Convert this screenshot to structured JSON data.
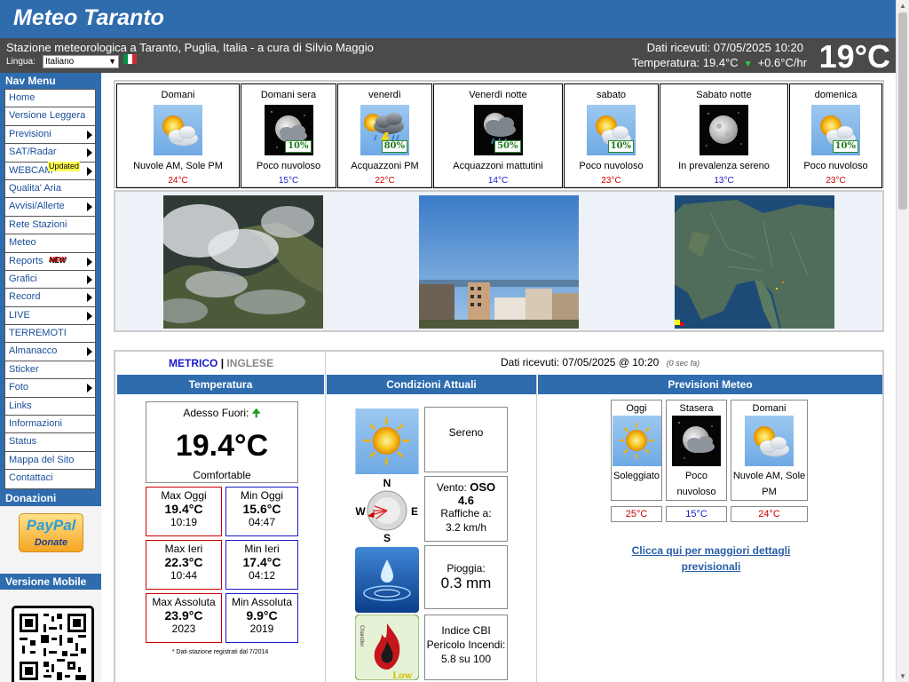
{
  "header": {
    "site_title": "Meteo Taranto",
    "station_line": "Stazione meteorologica a Taranto, Puglia, Italia - a cura di Silvio Maggio",
    "language_label": "Lingua:",
    "language_value": "Italiano",
    "data_received": "Dati ricevuti:  07/05/2025 10:20",
    "temperature_text": "Temperatura: 19.4°C",
    "temperature_trend": "+0.6°C/hr",
    "big_temp": "19°C"
  },
  "sidebar": {
    "nav_title": "Nav Menu",
    "items": [
      {
        "label": "Home",
        "arrow": false
      },
      {
        "label": "Versione Leggera",
        "arrow": false
      },
      {
        "label": "Previsioni",
        "arrow": true
      },
      {
        "label": "SAT/Radar",
        "arrow": true
      },
      {
        "label": "WEBCAM",
        "arrow": true,
        "badge": "Updated"
      },
      {
        "label": "Qualita' Aria",
        "arrow": false
      },
      {
        "label": "Avvisi/Allerte",
        "arrow": true
      },
      {
        "label": "Rete Stazioni",
        "arrow": false
      },
      {
        "label": "Meteo",
        "arrow": false
      },
      {
        "label": "Reports",
        "arrow": true,
        "badge": "NEW"
      },
      {
        "label": "Grafici",
        "arrow": true
      },
      {
        "label": "Record",
        "arrow": true
      },
      {
        "label": "LIVE",
        "arrow": true
      },
      {
        "label": "TERREMOTI",
        "arrow": false
      },
      {
        "label": "Almanacco",
        "arrow": true
      },
      {
        "label": "Sticker",
        "arrow": false
      },
      {
        "label": "Foto",
        "arrow": true
      },
      {
        "label": "Links",
        "arrow": false
      },
      {
        "label": "Informazioni",
        "arrow": false
      },
      {
        "label": "Status",
        "arrow": false
      },
      {
        "label": "Mappa del Sito",
        "arrow": false
      },
      {
        "label": "Contattaci",
        "arrow": false
      }
    ],
    "donations_title": "Donazioni",
    "paypal_label": "PayPal",
    "paypal_sub": "Donate",
    "mobile_title": "Versione Mobile"
  },
  "forecast": [
    {
      "title": "Domani",
      "icon": "partly-cloudy-sun-icon",
      "pop": "",
      "desc": "Nuvole AM, Sole PM",
      "temp": "24°C",
      "temp_color": "red"
    },
    {
      "title": "Domani sera",
      "icon": "cloudy-night-icon",
      "pop": "10%",
      "desc": "Poco nuvoloso",
      "temp": "15°C",
      "temp_color": "blue"
    },
    {
      "title": "venerdì",
      "icon": "thunderstorm-sun-icon",
      "pop": "80%",
      "desc": "Acquazzoni PM",
      "temp": "22°C",
      "temp_color": "red"
    },
    {
      "title": "Venerdì notte",
      "icon": "rain-night-icon",
      "pop": "50%",
      "desc": "Acquazzoni mattutini",
      "temp": "14°C",
      "temp_color": "blue"
    },
    {
      "title": "sabato",
      "icon": "partly-cloudy-sun-icon",
      "pop": "10%",
      "desc": "Poco nuvoloso",
      "temp": "23°C",
      "temp_color": "red"
    },
    {
      "title": "Sabato notte",
      "icon": "clear-night-icon",
      "pop": "",
      "desc": "In prevalenza sereno",
      "temp": "13°C",
      "temp_color": "blue"
    },
    {
      "title": "domenica",
      "icon": "partly-cloudy-sun-icon",
      "pop": "10%",
      "desc": "Poco nuvoloso",
      "temp": "23°C",
      "temp_color": "red"
    }
  ],
  "current": {
    "unit_metric": "METRICO",
    "unit_sep": "|",
    "unit_imperial": "INGLESE",
    "data_received": "Dati ricevuti: 07/05/2025 @ 10:20",
    "data_age": "(0 sec fa)",
    "col_temp": "Temperatura",
    "col_cond": "Condizioni Attuali",
    "col_prev": "Previsioni Meteo",
    "now_label": "Adesso Fuori:",
    "now_value": "19.4°C",
    "now_feel": "Comfortable",
    "max_today_label": "Max Oggi",
    "max_today_value": "19.4°C",
    "max_today_time": "10:19",
    "min_today_label": "Min Oggi",
    "min_today_value": "15.6°C",
    "min_today_time": "04:47",
    "max_yest_label": "Max Ieri",
    "max_yest_value": "22.3°C",
    "max_yest_time": "10:44",
    "min_yest_label": "Min Ieri",
    "min_yest_value": "17.4°C",
    "min_yest_time": "04:12",
    "max_abs_label": "Max Assoluta",
    "max_abs_value": "23.9°C",
    "max_abs_year": "2023",
    "min_abs_label": "Min Assoluta",
    "min_abs_value": "9.9°C",
    "min_abs_year": "2019",
    "records_note": "* Dati stazione registrati dal 7/2014",
    "cond_sky": "Sereno",
    "wind_label": "Vento:",
    "wind_dir": "OSO",
    "wind_speed": "4.6",
    "gust_label": "Raffiche a:",
    "gust_value": "3.2 km/h",
    "rain_label": "Pioggia:",
    "rain_value": "0.3 mm",
    "cbi_label": "Indice CBI",
    "cbi_sub": "Pericolo Incendi:",
    "cbi_value": "5.8 su 100",
    "cbi_level": "Low",
    "cbi_brand": "Chandler",
    "compass": {
      "n": "N",
      "s": "S",
      "e": "E",
      "w": "W"
    }
  },
  "prev_meteo": [
    {
      "title": "Oggi",
      "icon": "sunny-icon",
      "desc": "Soleggiato",
      "temp": "25°C",
      "temp_color": "red"
    },
    {
      "title": "Stasera",
      "icon": "cloudy-night-icon",
      "desc": "Poco nuvoloso",
      "temp": "15°C",
      "temp_color": "blue"
    },
    {
      "title": "Domani",
      "icon": "partly-cloudy-sun-icon",
      "desc": "Nuvole AM, Sole PM",
      "temp": "24°C",
      "temp_color": "red"
    }
  ],
  "prev_link": "Clicca qui per maggiori dettagli previsionali",
  "colors": {
    "header_blue": "#2e6cae",
    "subheader_gray": "#4a4a4a",
    "temp_red": "#cc0000",
    "temp_blue": "#1a1ac8"
  }
}
